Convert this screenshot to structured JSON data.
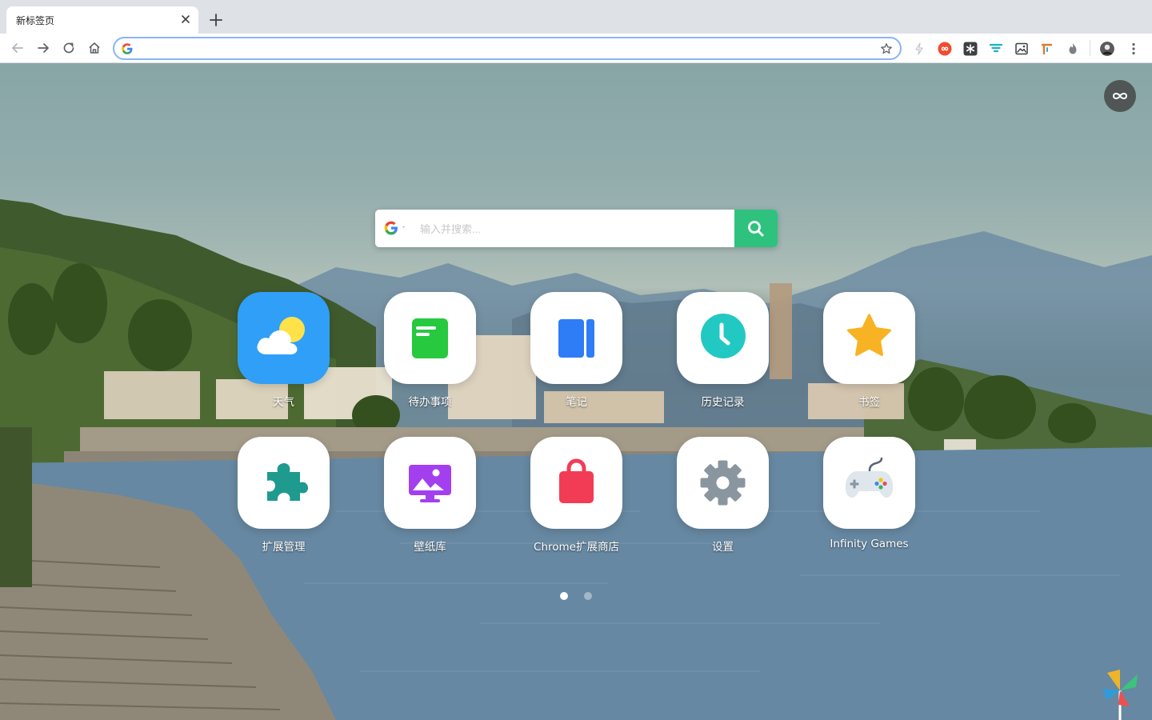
{
  "browser": {
    "tab_title": "新标签页",
    "omnibox_value": ""
  },
  "search": {
    "placeholder": "输入并搜索..."
  },
  "apps": [
    {
      "label": "天气",
      "icon": "weather-icon"
    },
    {
      "label": "待办事项",
      "icon": "todo-icon"
    },
    {
      "label": "笔记",
      "icon": "notes-icon"
    },
    {
      "label": "历史记录",
      "icon": "history-icon"
    },
    {
      "label": "书签",
      "icon": "bookmark-star-icon"
    },
    {
      "label": "扩展管理",
      "icon": "puzzle-icon"
    },
    {
      "label": "壁纸库",
      "icon": "wallpaper-icon"
    },
    {
      "label": "Chrome扩展商店",
      "icon": "store-bag-icon"
    },
    {
      "label": "设置",
      "icon": "gear-icon"
    },
    {
      "label": "Infinity Games",
      "icon": "gamepad-icon"
    }
  ],
  "pagination": {
    "pages": 2,
    "current": 1
  },
  "colors": {
    "accent_green": "#2ec27e",
    "weather_blue": "#2f9ff8",
    "todo_green": "#27c93f",
    "notes_blue": "#2e7cf6",
    "history_teal": "#22c9c3",
    "star_yellow": "#f7b323",
    "puzzle_teal": "#1f9a8e",
    "wallpaper_purple": "#a43ff0",
    "store_red": "#f23c56",
    "gear_gray": "#8a969f"
  }
}
